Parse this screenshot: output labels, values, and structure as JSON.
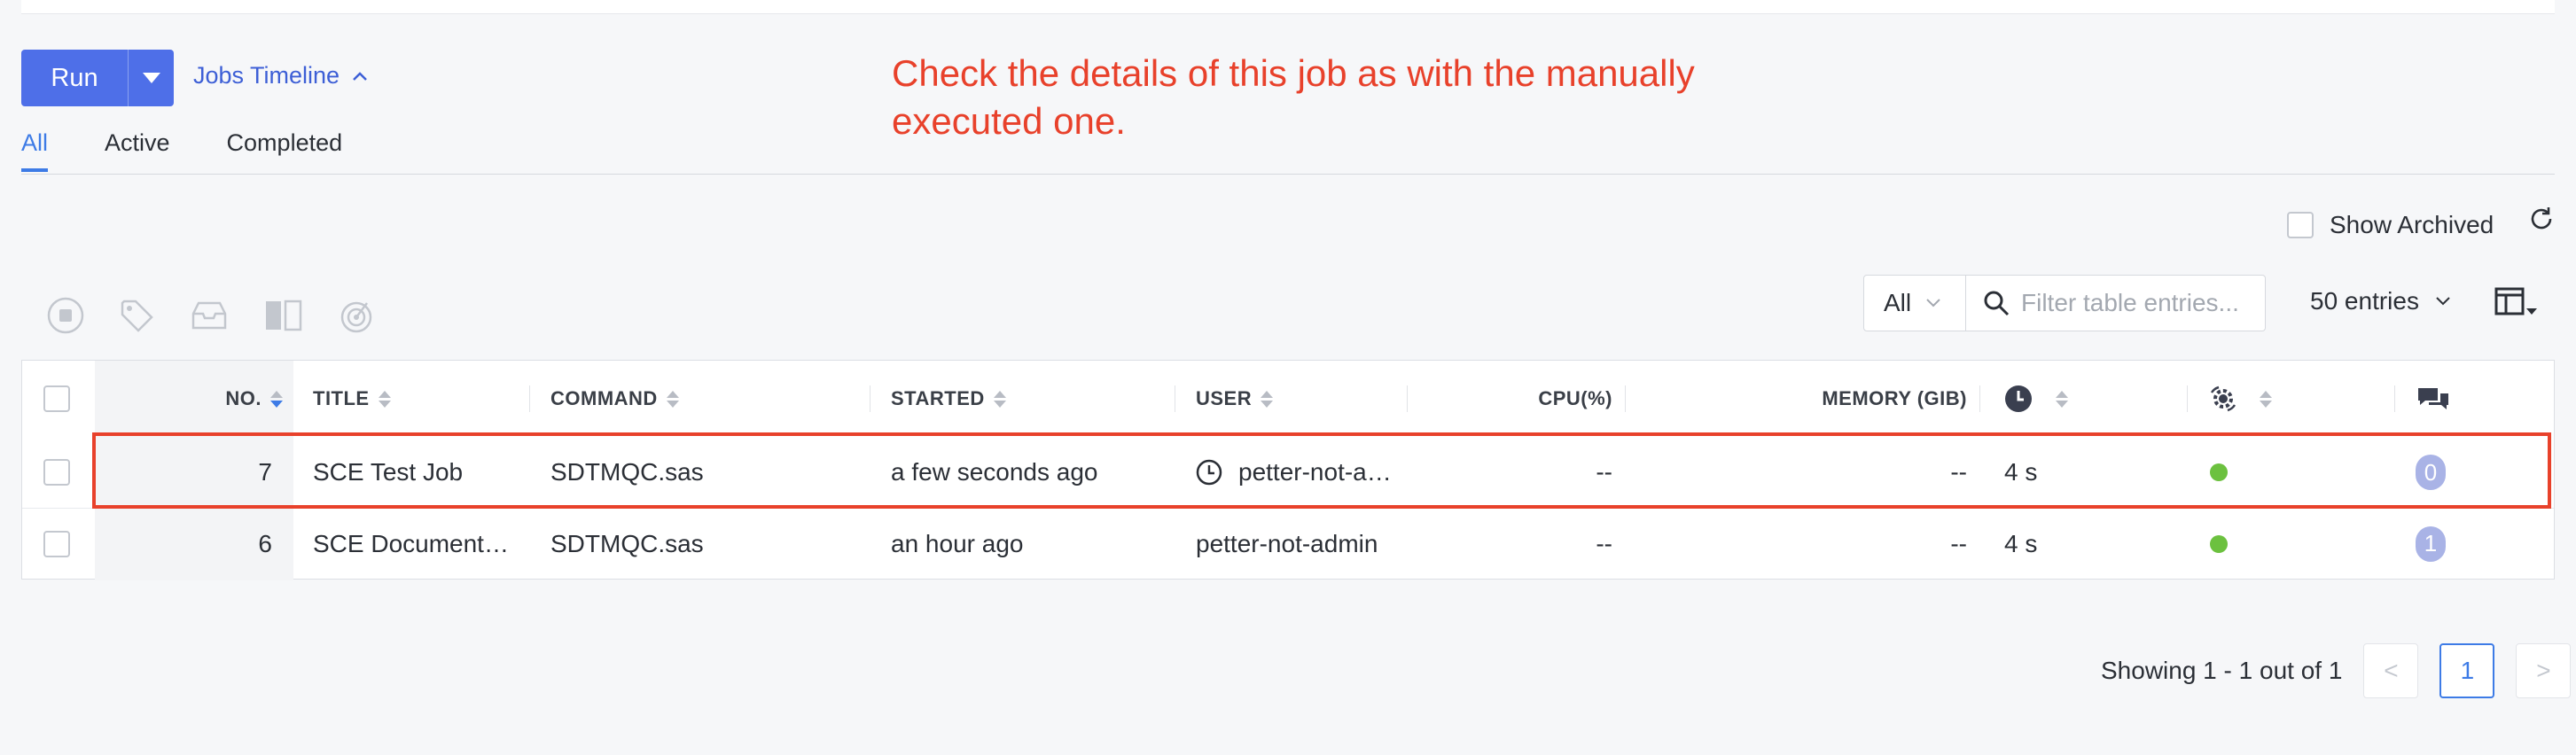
{
  "toolbar": {
    "run_label": "Run",
    "jobs_timeline_label": "Jobs Timeline"
  },
  "annotation": {
    "text": "Check the details of this job as with the manually executed one.",
    "color": "#e8412b"
  },
  "tabs": [
    {
      "label": "All",
      "active": true
    },
    {
      "label": "Active",
      "active": false
    },
    {
      "label": "Completed",
      "active": false
    }
  ],
  "show_archived_label": "Show Archived",
  "filter": {
    "select_value": "All",
    "placeholder": "Filter table entries...",
    "entries_label": "50 entries"
  },
  "table": {
    "headers": {
      "no": "NO.",
      "title": "TITLE",
      "command": "COMMAND",
      "started": "STARTED",
      "user": "USER",
      "cpu": "CPU(%)",
      "memory": "MEMORY (GIB)"
    },
    "rows": [
      {
        "no": "7",
        "title": "SCE Test Job",
        "command": "SDTMQC.sas",
        "started": "a few seconds ago",
        "user": "petter-not-a…",
        "scheduled": true,
        "cpu": "--",
        "memory": "--",
        "duration": "4 s",
        "status_color": "#6cc13f",
        "comments": "0"
      },
      {
        "no": "6",
        "title": "SCE Document…",
        "command": "SDTMQC.sas",
        "started": "an hour ago",
        "user": "petter-not-admin",
        "scheduled": false,
        "cpu": "--",
        "memory": "--",
        "duration": "4 s",
        "status_color": "#6cc13f",
        "comments": "1"
      }
    ]
  },
  "pagination": {
    "summary": "Showing 1 - 1 out of 1",
    "current_page": "1",
    "prev_label": "<",
    "next_label": ">"
  },
  "colors": {
    "accent": "#4e6fe8",
    "link": "#3d7be6",
    "status_ok": "#6cc13f"
  }
}
